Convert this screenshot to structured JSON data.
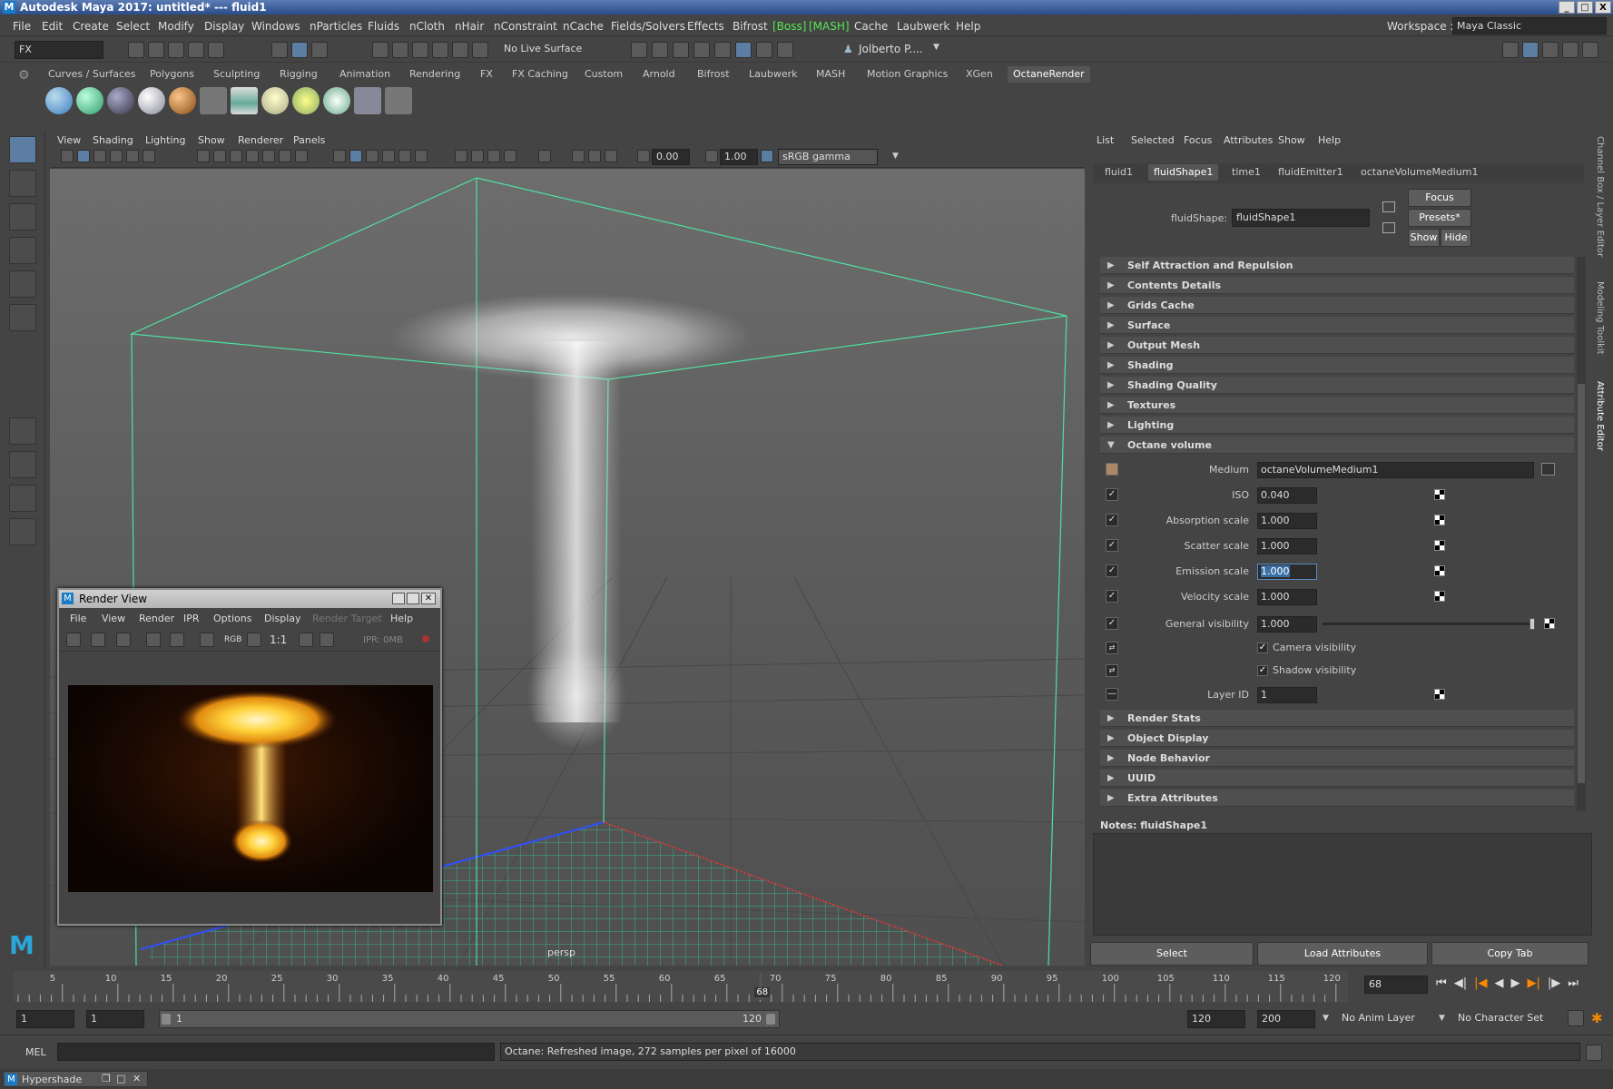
{
  "app": {
    "title": "Autodesk Maya 2017: untitled*   ---   fluid1",
    "workspace_label": "Workspace :",
    "workspace_value": "Maya Classic",
    "window_buttons": [
      "_",
      "□",
      "X"
    ]
  },
  "menubar": [
    "File",
    "Edit",
    "Create",
    "Select",
    "Modify",
    "Display",
    "Windows",
    "nParticles",
    "Fluids",
    "nCloth",
    "nHair",
    "nConstraint",
    "nCache",
    "Fields/Solvers",
    "Effects",
    "Bifrost",
    "[Boss]",
    "[MASH]",
    "Cache",
    "Laubwerk",
    "Help"
  ],
  "toolbar": {
    "menuset": "FX",
    "live_surface": "No Live Surface",
    "user": "Jolberto P...."
  },
  "shelf_tabs": [
    "Curves / Surfaces",
    "Polygons",
    "Sculpting",
    "Rigging",
    "Animation",
    "Rendering",
    "FX",
    "FX Caching",
    "Custom",
    "Arnold",
    "Bifrost",
    "Laubwerk",
    "MASH",
    "Motion Graphics",
    "XGen",
    "OctaneRender"
  ],
  "shelf_active": "OctaneRender",
  "viewport": {
    "menu": [
      "View",
      "Shading",
      "Lighting",
      "Show",
      "Renderer",
      "Panels"
    ],
    "exposure": "0.00",
    "gamma": "1.00",
    "color_space": "sRGB gamma",
    "camera_label": "persp"
  },
  "render_view": {
    "title": "Render View",
    "menu": [
      "File",
      "View",
      "Render",
      "IPR",
      "Options",
      "Display",
      "Render Target",
      "Help"
    ],
    "ratio": "1:1",
    "ipr_label": "IPR: 0MB",
    "rgb_label": "RGB"
  },
  "attribute_editor": {
    "menu": [
      "List",
      "Selected",
      "Focus",
      "Attributes",
      "Show",
      "Help"
    ],
    "tabs": [
      "fluid1",
      "fluidShape1",
      "time1",
      "fluidEmitter1",
      "octaneVolumeMedium1"
    ],
    "active_tab": "fluidShape1",
    "node_label": "fluidShape:",
    "node_value": "fluidShape1",
    "buttons": {
      "focus": "Focus",
      "presets": "Presets*",
      "show": "Show",
      "hide": "Hide"
    },
    "sections_top": [
      "Self Attraction and Repulsion",
      "Contents Details",
      "Grids Cache",
      "Surface",
      "Output Mesh",
      "Shading",
      "Shading Quality",
      "Textures",
      "Lighting"
    ],
    "open_section": "Octane volume",
    "medium_label": "Medium",
    "medium_value": "octaneVolumeMedium1",
    "attrs": [
      {
        "label": "ISO",
        "value": "0.040"
      },
      {
        "label": "Absorption scale",
        "value": "1.000"
      },
      {
        "label": "Scatter scale",
        "value": "1.000"
      },
      {
        "label": "Emission scale",
        "value": "1.000"
      },
      {
        "label": "Velocity scale",
        "value": "1.000"
      },
      {
        "label": "General visibility",
        "value": "1.000"
      }
    ],
    "general_visibility_level": 1.0,
    "checks": [
      {
        "label": "Camera visibility",
        "checked": true
      },
      {
        "label": "Shadow visibility",
        "checked": true
      }
    ],
    "layer_label": "Layer ID",
    "layer_value": "1",
    "sections_bottom": [
      "Render Stats",
      "Object Display",
      "Node Behavior",
      "UUID",
      "Extra Attributes"
    ],
    "notes_label": "Notes:  fluidShape1",
    "bottom_buttons": [
      "Select",
      "Load Attributes",
      "Copy Tab"
    ],
    "side_tabs": [
      "Channel Box / Layer Editor",
      "Modeling Toolkit",
      "Attribute Editor"
    ]
  },
  "timeline": {
    "ticks": [
      "5",
      "10",
      "15",
      "20",
      "25",
      "30",
      "35",
      "40",
      "45",
      "50",
      "55",
      "60",
      "65",
      "70",
      "75",
      "80",
      "85",
      "90",
      "95",
      "100",
      "105",
      "110",
      "115",
      "120"
    ],
    "current_frame": "68",
    "current_frame_field": "68"
  },
  "range": {
    "start": "1",
    "playback_start": "1",
    "slider_start": "1",
    "slider_end": "120",
    "playback_end": "120",
    "end": "200",
    "anim_layer": "No Anim Layer",
    "char_set": "No Character Set"
  },
  "command": {
    "lang": "MEL",
    "feedback": "Octane: Refreshed image, 272 samples per pixel of 16000"
  },
  "taskbar": {
    "item": "Hypershade"
  }
}
